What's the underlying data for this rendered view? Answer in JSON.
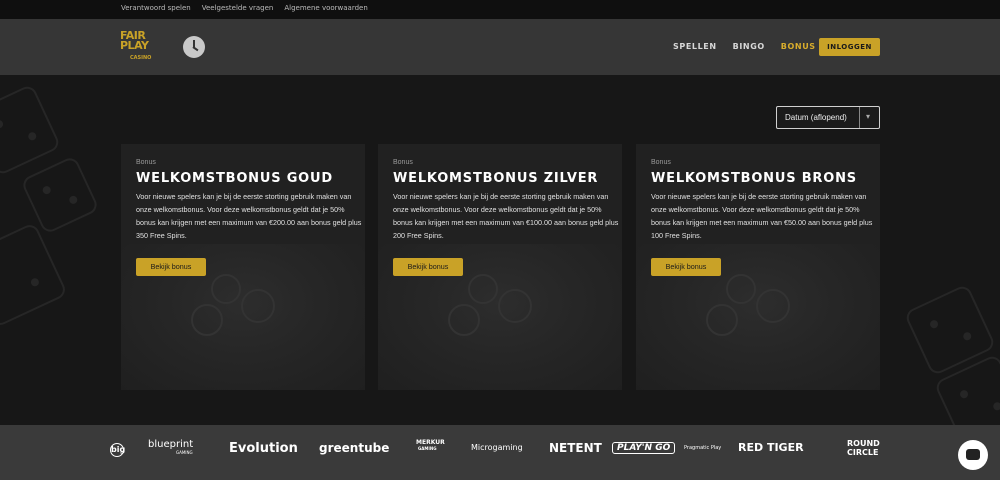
{
  "topbar": {
    "links": [
      "Verantwoord spelen",
      "Veelgestelde vragen",
      "Algemene voorwaarden"
    ]
  },
  "header": {
    "logo": {
      "line1": "FAIR",
      "line2": "PLAY",
      "line3": "CASINO"
    },
    "nav": [
      {
        "label": "SPELLEN",
        "active": false
      },
      {
        "label": "BINGO",
        "active": false
      },
      {
        "label": "BONUS",
        "active": true
      }
    ],
    "login_label": "INLOGGEN"
  },
  "sort": {
    "value": "Datum (aflopend)"
  },
  "cards": [
    {
      "label": "Bonus",
      "title": "WELKOMSTBONUS GOUD",
      "desc": "Voor nieuwe spelers kan je bij de eerste storting gebruik maken van onze welkomstbonus. Voor deze welkomstbonus geldt dat je 50% bonus kan krijgen met een maximum van €200.00 aan bonus geld plus 350 Free Spins.",
      "button": "Bekijk bonus"
    },
    {
      "label": "Bonus",
      "title": "WELKOMSTBONUS ZILVER",
      "desc": "Voor nieuwe spelers kan je bij de eerste storting gebruik maken van onze welkomstbonus. Voor deze welkomstbonus geldt dat je 50% bonus kan krijgen met een maximum van €100.00 aan bonus geld plus 200 Free Spins.",
      "button": "Bekijk bonus"
    },
    {
      "label": "Bonus",
      "title": "WELKOMSTBONUS BRONS",
      "desc": "Voor nieuwe spelers kan je bij de eerste storting gebruik maken van onze welkomstbonus. Voor deze welkomstbonus geldt dat je 50% bonus kan krijgen met een maximum van €50.00 aan bonus geld plus 100 Free Spins.",
      "button": "Bekijk bonus"
    }
  ],
  "providers": [
    {
      "name": "big"
    },
    {
      "name": "blueprint",
      "sub": "GAMING"
    },
    {
      "name": "Evolution"
    },
    {
      "name": "greentube"
    },
    {
      "name": "MERKUR",
      "sub": "GAMING"
    },
    {
      "name": "Microgaming"
    },
    {
      "name": "NETENT"
    },
    {
      "name": "PLAY'N GO"
    },
    {
      "name": "Pragmatic Play"
    },
    {
      "name": "RED TIGER"
    },
    {
      "name": "ROUND",
      "sub": "CIRCLE"
    }
  ],
  "colors": {
    "accent": "#c9a227",
    "header_bg": "#363636",
    "footer_bg": "#3a3a3a"
  },
  "icons": {
    "clock": "clock-icon",
    "chat": "chat-icon",
    "chevron": "chevron-down-icon"
  }
}
